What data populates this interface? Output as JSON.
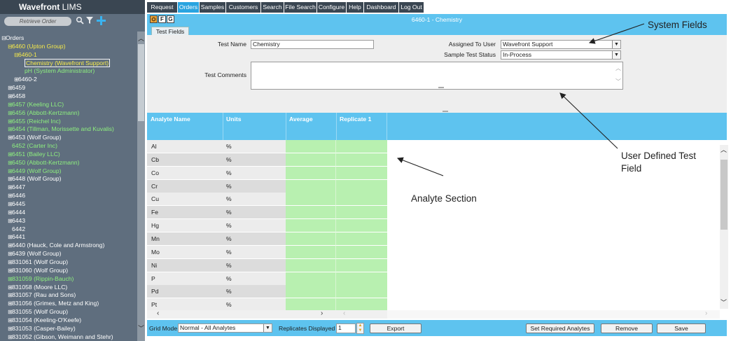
{
  "app": {
    "brand": "Wavefront",
    "brand_suffix": " LIMS"
  },
  "sidebar": {
    "retrieve_label": "Retrieve Order",
    "tree": [
      {
        "label": "Orders",
        "indent": 0,
        "color": "#ffffff",
        "expander": "⊟"
      },
      {
        "label": "6460 (Upton Group)",
        "indent": 1,
        "color": "#f5e94a",
        "expander": "⊟"
      },
      {
        "label": "6460-1",
        "indent": 2,
        "color": "#f5e94a",
        "expander": "⊟"
      },
      {
        "label": "Chemistry (Wavefront Support)",
        "indent": 3,
        "color": "#f5e94a",
        "expander": "",
        "selected": true
      },
      {
        "label": "pH (System Administrator)",
        "indent": 3,
        "color": "#8ef07e",
        "expander": ""
      },
      {
        "label": "6460-2",
        "indent": 2,
        "color": "#ffffff",
        "expander": "⊞"
      },
      {
        "label": "6459",
        "indent": 1,
        "color": "#ffffff",
        "expander": "⊞"
      },
      {
        "label": "6458",
        "indent": 1,
        "color": "#ffffff",
        "expander": "⊞"
      },
      {
        "label": "6457 (Keeling LLC)",
        "indent": 1,
        "color": "#8ef07e",
        "expander": "⊞"
      },
      {
        "label": "6456 (Abbott-Kertzmann)",
        "indent": 1,
        "color": "#8ef07e",
        "expander": "⊞"
      },
      {
        "label": "6455 (Reichel Inc)",
        "indent": 1,
        "color": "#8ef07e",
        "expander": "⊞"
      },
      {
        "label": "6454 (Tillman, Morissette and Kuvalis)",
        "indent": 1,
        "color": "#8ef07e",
        "expander": "⊞"
      },
      {
        "label": "6453 (Wolf Group)",
        "indent": 1,
        "color": "#ffffff",
        "expander": "⊞"
      },
      {
        "label": "6452 (Carter Inc)",
        "indent": 1,
        "color": "#8ef07e",
        "expander": ""
      },
      {
        "label": "6451 (Bailey LLC)",
        "indent": 1,
        "color": "#8ef07e",
        "expander": "⊞"
      },
      {
        "label": "6450 (Abbott-Kertzmann)",
        "indent": 1,
        "color": "#8ef07e",
        "expander": "⊞"
      },
      {
        "label": "6449 (Wolf Group)",
        "indent": 1,
        "color": "#8ef07e",
        "expander": "⊞"
      },
      {
        "label": "6448 (Wolf Group)",
        "indent": 1,
        "color": "#ffffff",
        "expander": "⊞"
      },
      {
        "label": "6447",
        "indent": 1,
        "color": "#ffffff",
        "expander": "⊞"
      },
      {
        "label": "6446",
        "indent": 1,
        "color": "#ffffff",
        "expander": "⊞"
      },
      {
        "label": "6445",
        "indent": 1,
        "color": "#ffffff",
        "expander": "⊞"
      },
      {
        "label": "6444",
        "indent": 1,
        "color": "#ffffff",
        "expander": "⊞"
      },
      {
        "label": "6443",
        "indent": 1,
        "color": "#ffffff",
        "expander": "⊞"
      },
      {
        "label": "6442",
        "indent": 1,
        "color": "#ffffff",
        "expander": ""
      },
      {
        "label": "6441",
        "indent": 1,
        "color": "#ffffff",
        "expander": "⊞"
      },
      {
        "label": "6440 (Hauck, Cole and Armstrong)",
        "indent": 1,
        "color": "#ffffff",
        "expander": "⊞"
      },
      {
        "label": "6439 (Wolf Group)",
        "indent": 1,
        "color": "#ffffff",
        "expander": "⊞"
      },
      {
        "label": "831061 (Wolf Group)",
        "indent": 1,
        "color": "#ffffff",
        "expander": "⊞"
      },
      {
        "label": "831060 (Wolf Group)",
        "indent": 1,
        "color": "#ffffff",
        "expander": "⊞"
      },
      {
        "label": "831059 (Rippin-Bauch)",
        "indent": 1,
        "color": "#8ef07e",
        "expander": "⊞"
      },
      {
        "label": "831058 (Moore LLC)",
        "indent": 1,
        "color": "#ffffff",
        "expander": "⊞"
      },
      {
        "label": "831057 (Rau and Sons)",
        "indent": 1,
        "color": "#ffffff",
        "expander": "⊞"
      },
      {
        "label": "831056 (Grimes, Metz and King)",
        "indent": 1,
        "color": "#ffffff",
        "expander": "⊞"
      },
      {
        "label": "831055 (Wolf Group)",
        "indent": 1,
        "color": "#ffffff",
        "expander": "⊞"
      },
      {
        "label": "831054 (Keeling-O'Keefe)",
        "indent": 1,
        "color": "#ffffff",
        "expander": "⊞"
      },
      {
        "label": "831053 (Casper-Bailey)",
        "indent": 1,
        "color": "#ffffff",
        "expander": "⊞"
      },
      {
        "label": "831052 (Gibson, Weimann and Stehr)",
        "indent": 1,
        "color": "#ffffff",
        "expander": "⊞"
      }
    ]
  },
  "menu": [
    {
      "label": "Request",
      "active": false
    },
    {
      "label": "Orders",
      "active": true
    },
    {
      "label": "Samples",
      "active": false
    },
    {
      "label": "Customers",
      "active": false
    },
    {
      "label": "Search",
      "active": false
    },
    {
      "label": "File Search",
      "active": false
    },
    {
      "label": "Configure",
      "active": false
    },
    {
      "label": "Help",
      "active": false
    },
    {
      "label": "Dashboard",
      "active": false
    },
    {
      "label": "Log Out",
      "active": false
    }
  ],
  "header": {
    "title": "6460-1 - Chemistry",
    "tool1": "F",
    "tool2": "G"
  },
  "tab": {
    "label": "Test Fields"
  },
  "form": {
    "test_name_label": "Test Name",
    "test_name_value": "Chemistry",
    "assigned_label": "Assigned To User",
    "assigned_value": "Wavefront Support",
    "status_label": "Sample Test Status",
    "status_value": "In-Process",
    "comments_label": "Test Comments",
    "comments_value": ""
  },
  "grid": {
    "columns": [
      "Analyte Name",
      "Units",
      "Average",
      "Replicate 1"
    ],
    "rows": [
      [
        "Al",
        "%"
      ],
      [
        "Cb",
        "%"
      ],
      [
        "Co",
        "%"
      ],
      [
        "Cr",
        "%"
      ],
      [
        "Cu",
        "%"
      ],
      [
        "Fe",
        "%"
      ],
      [
        "Hg",
        "%"
      ],
      [
        "Mn",
        "%"
      ],
      [
        "Mo",
        "%"
      ],
      [
        "Ni",
        "%"
      ],
      [
        "P",
        "%"
      ],
      [
        "Pd",
        "%"
      ],
      [
        "Pt",
        "%"
      ]
    ]
  },
  "bottom": {
    "grid_mode_label": "Grid Mode",
    "grid_mode_value": "Normal - All Analytes",
    "replicates_label": "Replicates Displayed",
    "replicates_value": "1",
    "export_label": "Export",
    "set_required_label": "Set Required Analytes",
    "remove_label": "Remove",
    "save_label": "Save"
  },
  "annotations": {
    "system_fields": "System Fields",
    "user_defined_line1": "User Defined Test",
    "user_defined_line2": "Field",
    "analyte_section": "Analyte Section"
  },
  "colors": {
    "accent": "#5ec3ef",
    "menu_bg": "#3a4652",
    "menu_active": "#29a4e0",
    "sidebar_bg": "#5f6e7e",
    "cell_green": "#b8f0b0"
  }
}
